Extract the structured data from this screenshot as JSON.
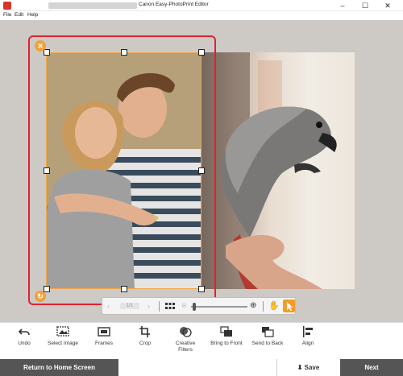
{
  "window": {
    "title": "Canon Easy-PhotoPrint Editor",
    "minimize": "–",
    "maximize": "☐",
    "close": "✕"
  },
  "menu": [
    "File",
    "Edit",
    "Help"
  ],
  "canvas": {
    "photos": [
      "couple-photo",
      "parrot-photo"
    ],
    "selected_photo": "couple-photo"
  },
  "floatbar": {
    "page_indicator": "1/1",
    "zoom_level": 0.05
  },
  "tools": [
    {
      "label": "Undo",
      "icon": "undo-icon"
    },
    {
      "label": "Select Image",
      "icon": "select-image-icon"
    },
    {
      "label": "Frames",
      "icon": "frames-icon"
    },
    {
      "label": "Crop",
      "icon": "crop-icon"
    },
    {
      "label": "Creative\nFilters",
      "icon": "creative-filters-icon"
    },
    {
      "label": "Bring to Front",
      "icon": "bring-to-front-icon"
    },
    {
      "label": "Send to Back",
      "icon": "send-to-back-icon"
    },
    {
      "label": "Align",
      "icon": "align-icon"
    }
  ],
  "bottom": {
    "home_label": "Return to Home Screen",
    "save_label": "Save",
    "next_label": "Next"
  },
  "colors": {
    "accent_orange": "#f39c2a",
    "selection_red": "#e2222f",
    "dark_button": "#555555",
    "workspace": "#cdcac6"
  }
}
